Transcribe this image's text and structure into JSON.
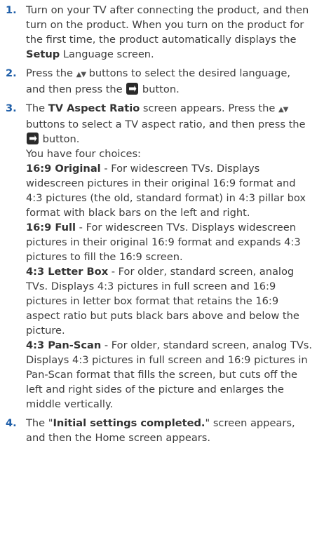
{
  "steps": [
    {
      "number": "1.",
      "t1": "Turn on your TV after connecting the product, and then turn on the product. When you turn on the product for the first time, the product automatically displays the ",
      "b1": "Setup",
      "t2": " Language screen."
    },
    {
      "number": "2.",
      "t1": "Press the ",
      "arrows": "▲▼",
      "t2": " buttons to select the desired language, and then press the ",
      "t3": " button."
    },
    {
      "number": "3.",
      "t1": "The ",
      "b1": "TV Aspect Ratio",
      "t2": " screen appears. Press the ",
      "arrows": "▲▼",
      "t3": " buttons to select a TV aspect ratio, and then press the ",
      "t4": " button.",
      "choices_intro": "You have four choices:",
      "options": [
        {
          "name": "16:9 Original",
          "desc": " - For widescreen TVs. Displays widescreen pictures in their original 16:9 format and 4:3 pictures (the old, standard format) in 4:3 pillar box format with black bars on the left and right."
        },
        {
          "name": "16:9 Full",
          "desc": " - For widescreen TVs. Displays widescreen pictures in their original 16:9 format and expands 4:3 pictures to fill the 16:9 screen."
        },
        {
          "name": "4:3 Letter Box",
          "desc": " - For older, standard screen, analog TVs. Displays 4:3 pictures in full screen and 16:9 pictures in letter box format that retains the 16:9 aspect ratio but puts black bars above and below the picture."
        },
        {
          "name": "4:3 Pan-Scan",
          "desc": " - For older, standard screen, analog TVs. Displays 4:3 pictures in full screen and 16:9 pictures in Pan-Scan format that fills the screen, but cuts off the left and right sides of the picture and enlarges the middle vertically."
        }
      ]
    },
    {
      "number": "4.",
      "t1": "The \"",
      "b1": "Initial settings completed.",
      "t2": "\" screen appears, and then the Home screen appears."
    }
  ],
  "colors": {
    "number": "#1e5ea8",
    "text": "#3c3c3c",
    "icon": "#2a2a2a"
  },
  "icons": {
    "enter": "enter-button-icon",
    "updown": "up-down-arrows-icon"
  }
}
